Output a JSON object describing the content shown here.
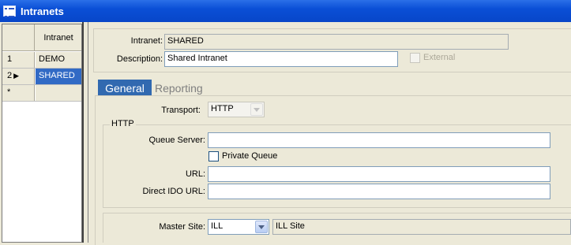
{
  "window": {
    "title": "Intranets"
  },
  "grid": {
    "column_header": "Intranet",
    "rows": [
      {
        "num": "1",
        "value": "DEMO",
        "current": false
      },
      {
        "num": "2",
        "value": "SHARED",
        "current": true
      }
    ],
    "new_row_marker": "*"
  },
  "form": {
    "intranet_label": "Intranet:",
    "intranet_value": "SHARED",
    "description_label": "Description:",
    "description_value": "Shared Intranet",
    "external_label": "External"
  },
  "tabs": [
    {
      "label": "General",
      "active": true
    },
    {
      "label": "Reporting",
      "active": false
    }
  ],
  "general": {
    "transport_label": "Transport:",
    "transport_value": "HTTP",
    "http_group_label": "HTTP",
    "queue_server_label": "Queue Server:",
    "queue_server_value": "",
    "private_queue_label": "Private Queue",
    "url_label": "URL:",
    "url_value": "",
    "direct_ido_url_label": "Direct IDO URL:",
    "direct_ido_url_value": "",
    "master_site_label": "Master Site:",
    "master_site_value": "ILL",
    "master_site_desc": "ILL Site"
  },
  "colors": {
    "titlebar": "#0a4fd6",
    "selection": "#316ac5",
    "tab_active": "#3169b0",
    "window_bg": "#ece9d8"
  }
}
